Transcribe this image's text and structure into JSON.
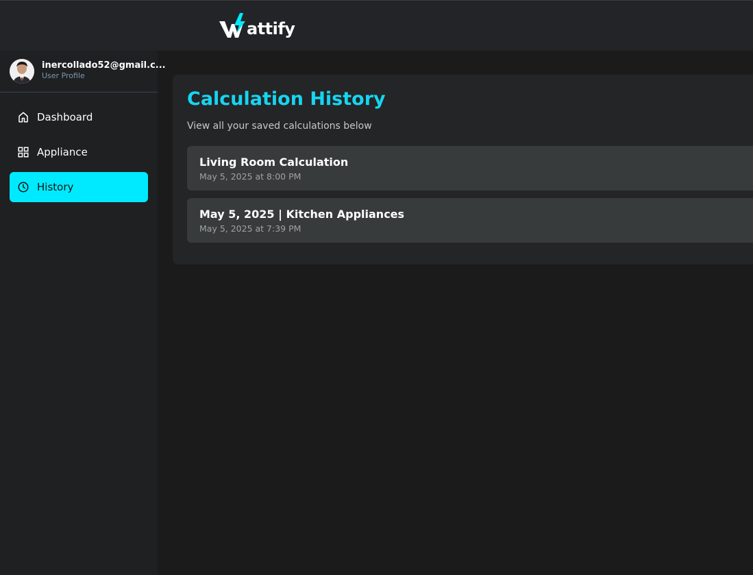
{
  "brand": {
    "name": "attify",
    "accent": "#00eaff"
  },
  "user": {
    "email": "inercollado52@gmail.c...",
    "profile_label": "User Profile"
  },
  "nav": {
    "items": [
      {
        "label": "Dashboard",
        "icon": "home-icon",
        "active": false
      },
      {
        "label": "Appliance",
        "icon": "grid-icon",
        "active": false
      },
      {
        "label": "History",
        "icon": "clock-icon",
        "active": true
      }
    ]
  },
  "history": {
    "title": "Calculation History",
    "subtitle": "View all your saved calculations below",
    "items": [
      {
        "title": "Living Room Calculation",
        "date": "May 5, 2025 at 8:00 PM"
      },
      {
        "title": "May 5, 2025 | Kitchen Appliances",
        "date": "May 5, 2025 at 7:39 PM"
      }
    ]
  }
}
